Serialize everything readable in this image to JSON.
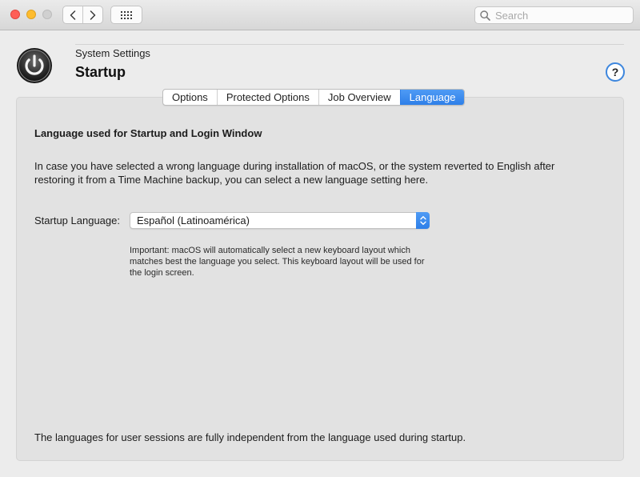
{
  "titlebar": {
    "search": {
      "placeholder": "Search",
      "value": ""
    }
  },
  "header": {
    "subtitle": "System Settings",
    "title": "Startup",
    "help_label": "?"
  },
  "tabs": [
    {
      "label": "Options",
      "active": false
    },
    {
      "label": "Protected Options",
      "active": false
    },
    {
      "label": "Job Overview",
      "active": false
    },
    {
      "label": "Language",
      "active": true
    }
  ],
  "language_pane": {
    "heading": "Language used for Startup and Login Window",
    "intro": "In case you have selected a wrong language during installation of macOS, or the system reverted to English after restoring it from a Time Machine backup, you can select a new language setting here.",
    "startup_language_label": "Startup Language:",
    "startup_language_value": "Español (Latinoamérica)",
    "note": "Important: macOS will automatically select a new keyboard layout which matches best the language you select. This keyboard layout will be used for the login screen.",
    "footer": "The languages for user sessions are fully independent from the language used during startup."
  },
  "colors": {
    "accent": "#2e7fe8",
    "close": "#fe5f57",
    "minimize": "#febc2e",
    "zoom_inactive": "#d0d0d0"
  },
  "icons": [
    "back-arrow-icon",
    "forward-arrow-icon",
    "grid-icon",
    "search-icon",
    "power-icon",
    "updown-chevron-icon"
  ]
}
